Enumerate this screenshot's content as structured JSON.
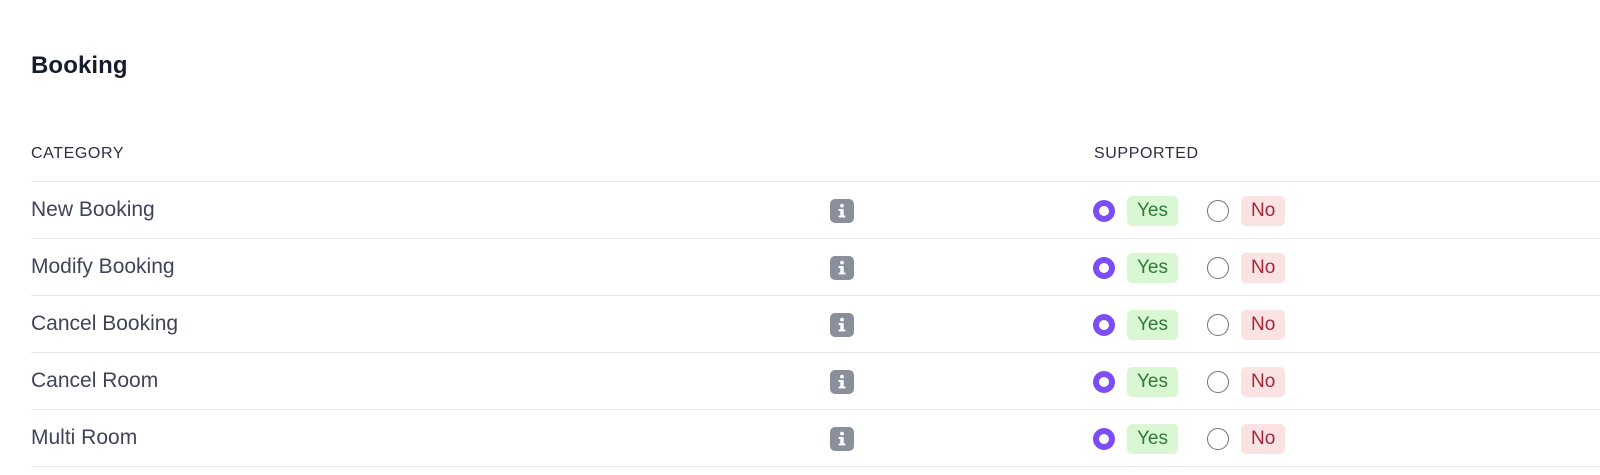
{
  "section": {
    "title": "Booking"
  },
  "table": {
    "headers": {
      "category": "CATEGORY",
      "supported": "SUPPORTED"
    },
    "options": {
      "yes_label": "Yes",
      "no_label": "No"
    },
    "rows": [
      {
        "label": "New Booking",
        "supported": "Yes"
      },
      {
        "label": "Modify Booking",
        "supported": "Yes"
      },
      {
        "label": "Cancel Booking",
        "supported": "Yes"
      },
      {
        "label": "Cancel Room",
        "supported": "Yes"
      },
      {
        "label": "Multi Room",
        "supported": "Yes"
      }
    ]
  },
  "icons": {
    "info": "info-icon"
  },
  "colors": {
    "accent": "#7c4df5",
    "yes_bg": "#d9f7d2",
    "yes_text": "#2f7a3a",
    "no_bg": "#fbe3e4",
    "no_text": "#a3283a",
    "icon_bg": "#8a8f9c"
  }
}
